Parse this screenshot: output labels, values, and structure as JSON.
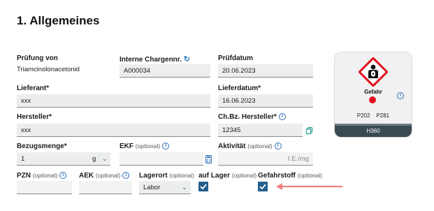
{
  "section": {
    "title": "1. Allgemeines"
  },
  "pruefung": {
    "label": "Prüfung von",
    "value": "Triamcinolonacetonid"
  },
  "charge": {
    "label": "Interne Chargennr.",
    "value": "A000034"
  },
  "pruefdatum": {
    "label": "Prüfdatum",
    "value": "20.06.2023"
  },
  "lieferant": {
    "label": "Lieferant*",
    "value": "xxx"
  },
  "lieferdatum": {
    "label": "Lieferdatum*",
    "value": "16.06.2023"
  },
  "hersteller": {
    "label": "Hersteller*",
    "value": "xxx"
  },
  "chbz": {
    "label": "Ch.Bz. Hersteller*",
    "value": "12345"
  },
  "bezugsmenge": {
    "label": "Bezugsmenge*",
    "value": "1",
    "unit": "g"
  },
  "ekf": {
    "label": "EKF",
    "optional": "(optional)"
  },
  "aktivitaet": {
    "label": "Aktivität",
    "optional": "(optional)",
    "unit": "I.E./mg"
  },
  "pzn": {
    "label": "PZN",
    "optional": "(optional)"
  },
  "aek": {
    "label": "AEK",
    "optional": "(optional)"
  },
  "lagerort": {
    "label": "Lagerort",
    "optional": "(optional)",
    "value": "Labor"
  },
  "auflager": {
    "label": "auf Lager",
    "optional": "(optional)",
    "checked": true
  },
  "gefahrstoff": {
    "label": "Gefahrstoff",
    "optional": "(optional)",
    "checked": true
  },
  "hazard": {
    "signal_word": "Gefahr",
    "p_codes": [
      "P202",
      "P281"
    ],
    "h_code": "H360",
    "pictogram": "health-hazard-icon",
    "signal_color": "#e0101e"
  },
  "colors": {
    "accent": "#245e8c",
    "info": "#2b6fb8",
    "arrow": "#f08080"
  }
}
